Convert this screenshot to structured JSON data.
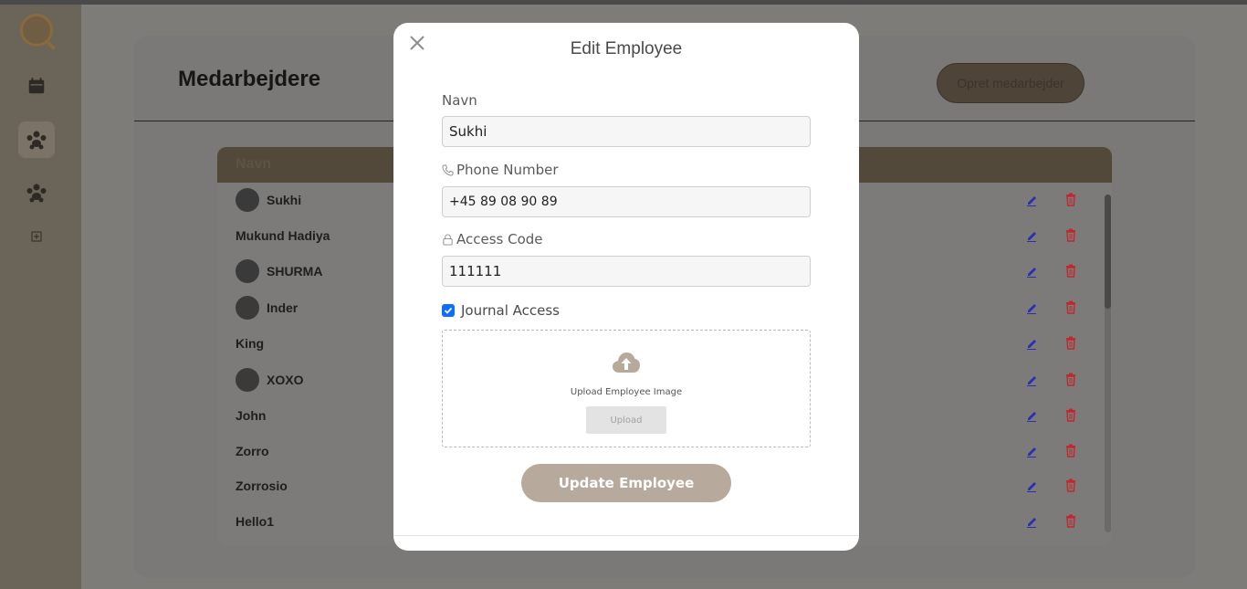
{
  "sidebar": {
    "items": [
      {
        "icon": "calendar-icon"
      },
      {
        "icon": "employees-icon",
        "active": true
      },
      {
        "icon": "group-icon"
      },
      {
        "icon": "small-grid-icon"
      }
    ]
  },
  "page": {
    "title": "Medarbejdere",
    "create_button": "Opret medarbejder"
  },
  "table": {
    "header": "Navn",
    "rows": [
      {
        "name": "Sukhi",
        "avatar": true
      },
      {
        "name": "Mukund Hadiya",
        "avatar": false
      },
      {
        "name": "SHURMA",
        "avatar": true
      },
      {
        "name": "Inder",
        "avatar": true
      },
      {
        "name": "King",
        "avatar": false
      },
      {
        "name": "XOXO",
        "avatar": true
      },
      {
        "name": "John",
        "avatar": false
      },
      {
        "name": "Zorro",
        "avatar": false
      },
      {
        "name": "Zorrosio",
        "avatar": false
      },
      {
        "name": "Hello1",
        "avatar": false
      }
    ]
  },
  "modal": {
    "title": "Edit Employee",
    "fields": {
      "name_label": "Navn",
      "name_value": "Sukhi",
      "phone_label": "Phone Number",
      "phone_value": "+45 89 08 90 89",
      "access_label": "Access Code",
      "access_value": "111111"
    },
    "journal_access_label": "Journal Access",
    "journal_access_checked": true,
    "upload_text": "Upload Employee Image",
    "upload_button": "Upload",
    "submit_button": "Update Employee"
  },
  "colors": {
    "accent": "#b7aa9d",
    "checkbox": "#0d6efd",
    "edit": "#2a2fb3",
    "delete": "#c0282d"
  }
}
